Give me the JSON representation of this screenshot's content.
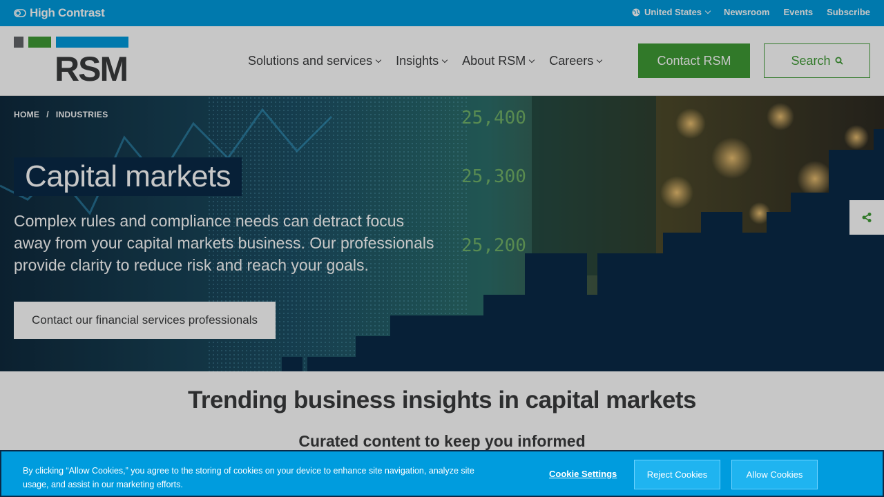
{
  "topbar": {
    "high_contrast": "High Contrast",
    "country": "United States",
    "links": [
      "Newsroom",
      "Events",
      "Subscribe"
    ]
  },
  "header": {
    "logo_text": "RSM",
    "nav": [
      "Solutions and services",
      "Insights",
      "About RSM",
      "Careers"
    ],
    "contact_label": "Contact RSM",
    "search_label": "Search"
  },
  "hero": {
    "breadcrumb": [
      "HOME",
      "INDUSTRIES"
    ],
    "breadcrumb_sep": "/",
    "title": "Capital markets",
    "description": "Complex rules and compliance needs can detract focus away from your capital markets business. Our professionals provide clarity to reduce risk and reach your goals.",
    "cta_label": "Contact our financial services professionals",
    "ticker_values": [
      "25,400",
      "25,300",
      "25,200"
    ]
  },
  "main": {
    "title": "Trending business insights in capital markets",
    "subtitle": "Curated content to keep you informed"
  },
  "cookie": {
    "text": "By clicking “Allow Cookies,” you agree to the storing of cookies on your device to enhance site navigation, analyze site usage, and assist in our marketing efforts.",
    "settings_label": "Cookie Settings",
    "reject_label": "Reject Cookies",
    "allow_label": "Allow Cookies"
  },
  "colors": {
    "brand_blue": "#009cde",
    "brand_green": "#3f9c35",
    "brand_gray": "#63666a",
    "navy": "#0a2947"
  }
}
